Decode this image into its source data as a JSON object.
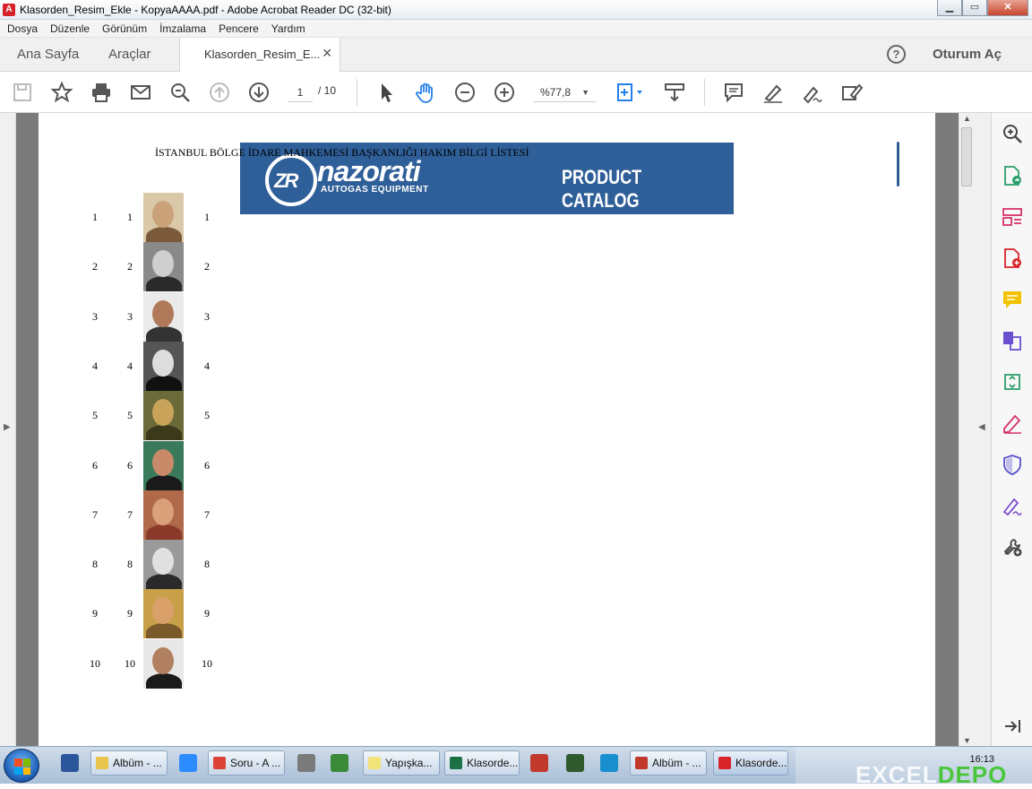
{
  "window": {
    "title": "Klasorden_Resim_Ekle - KopyaAAAA.pdf - Adobe Acrobat Reader DC (32-bit)",
    "app_icon": "acrobat-icon",
    "minimize": "▁",
    "maximize": "▭",
    "close": "✕"
  },
  "menu": [
    "Dosya",
    "Düzenle",
    "Görünüm",
    "İmzalama",
    "Pencere",
    "Yardım"
  ],
  "tabs": {
    "home": "Ana Sayfa",
    "tools": "Araçlar",
    "document": "Klasorden_Resim_E...",
    "close_symbol": "✕",
    "help_symbol": "?",
    "signin": "Oturum Aç"
  },
  "toolbar": {
    "current_page": "1",
    "total_pages": "/ 10",
    "zoom": "%77,8",
    "zoom_caret": "▼"
  },
  "document": {
    "heading": "İSTANBUL BÖLGE İDARE MAHKEMESİ BAŞKANLIĞI HAKIM BİLGİ LİSTESİ",
    "banner": {
      "brand": "nazorati",
      "logo_mark": "ZR",
      "subtitle": "AUTOGAS EQUIPMENT",
      "catalog": "PRODUCT CATALOG",
      "color": "#2f5f98"
    },
    "rows": [
      {
        "a": "1",
        "b": "1",
        "c": "1",
        "bg": "#d9c9a8",
        "skin": "#c9a27a",
        "cloth": "#7a5a3a"
      },
      {
        "a": "2",
        "b": "2",
        "c": "2",
        "bg": "#8a8a8a",
        "skin": "#cfcfcf",
        "cloth": "#2a2a2a"
      },
      {
        "a": "3",
        "b": "3",
        "c": "3",
        "bg": "#eaeaea",
        "skin": "#b07a5a",
        "cloth": "#333333"
      },
      {
        "a": "4",
        "b": "4",
        "c": "4",
        "bg": "#555555",
        "skin": "#dddddd",
        "cloth": "#111111"
      },
      {
        "a": "5",
        "b": "5",
        "c": "5",
        "bg": "#6b6a3a",
        "skin": "#c9a35a",
        "cloth": "#3a3a1a"
      },
      {
        "a": "6",
        "b": "6",
        "c": "6",
        "bg": "#3a7a5a",
        "skin": "#c98a6a",
        "cloth": "#1a1a1a"
      },
      {
        "a": "7",
        "b": "7",
        "c": "7",
        "bg": "#b06a4a",
        "skin": "#d9a07a",
        "cloth": "#8a3a2a"
      },
      {
        "a": "8",
        "b": "8",
        "c": "8",
        "bg": "#9a9a9a",
        "skin": "#e0e0e0",
        "cloth": "#2a2a2a"
      },
      {
        "a": "9",
        "b": "9",
        "c": "9",
        "bg": "#c9a04a",
        "skin": "#d9a06a",
        "cloth": "#7a5a2a"
      },
      {
        "a": "10",
        "b": "10",
        "c": "10",
        "bg": "#e8e8e8",
        "skin": "#b08060",
        "cloth": "#1a1a1a"
      }
    ]
  },
  "taskbar": {
    "items": [
      {
        "label": "Albüm - ...",
        "color": "#e8c44a"
      },
      {
        "label": "Soru - A ...",
        "color": "#db4437"
      },
      {
        "label": "Yapışka...",
        "color": "#f2e27a"
      },
      {
        "label": "Klasorde...",
        "color": "#1e7145"
      },
      {
        "label": "Albüm - ...",
        "color": "#c0392b"
      },
      {
        "label": "Klasorde...",
        "color": "#d8232a"
      }
    ],
    "clock": "16:13",
    "watermark_a": "EXCEL",
    "watermark_b": "DEPO"
  },
  "colors": {
    "accent": "#2680eb",
    "taskbar": "#b9cbe0"
  }
}
